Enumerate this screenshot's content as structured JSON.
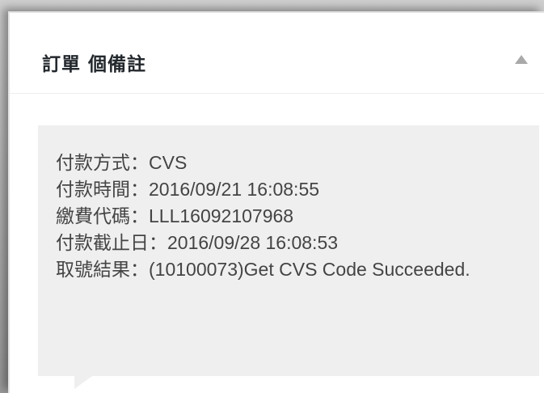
{
  "panel": {
    "title": "訂單 個備註",
    "toggle_icon": "triangle-up-icon"
  },
  "note": {
    "lines": [
      "付款方式：CVS",
      "付款時間：2016/09/21 16:08:55",
      "繳費代碼：LLL16092107968",
      "付款截止日：2016/09/28 16:08:53",
      "取號結果：(10100073)Get CVS Code Succeeded."
    ]
  },
  "colors": {
    "note_background": "#efefef",
    "title_text": "#23282d",
    "note_text": "#444444",
    "arrow": "#a9a9a9"
  }
}
